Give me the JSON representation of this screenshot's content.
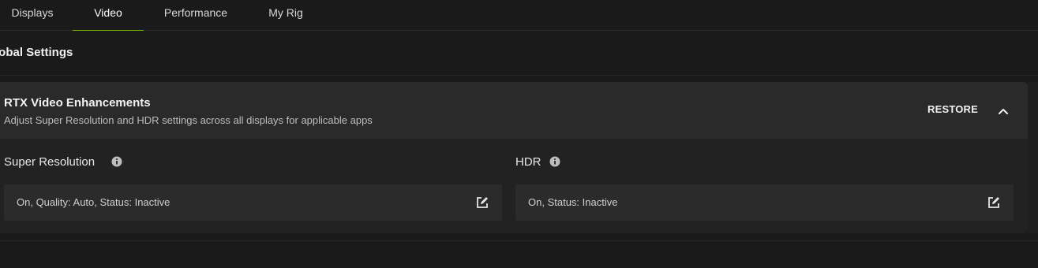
{
  "tabs": [
    {
      "label": "Displays",
      "active": false
    },
    {
      "label": "Video",
      "active": true
    },
    {
      "label": "Performance",
      "active": false
    },
    {
      "label": "My Rig",
      "active": false
    }
  ],
  "section": {
    "title": "lobal Settings"
  },
  "card": {
    "title": "RTX Video Enhancements",
    "subtitle": "Adjust Super Resolution and HDR settings across all displays for applicable apps",
    "restore_label": "RESTORE",
    "collapse_icon": "chevron-up-icon",
    "settings": [
      {
        "label": "Super Resolution",
        "info_icon": "info-icon",
        "value": "On, Quality: Auto, Status: Inactive",
        "edit_icon": "edit-icon"
      },
      {
        "label": "HDR",
        "info_icon": "info-icon",
        "value": "On, Status: Inactive",
        "edit_icon": "edit-icon"
      }
    ]
  },
  "colors": {
    "background": "#1a1a1a",
    "card_header": "#2a2a2a",
    "card_body": "#222222",
    "value_box": "#2b2b2b",
    "accent": "#76b900",
    "text_primary": "#f2f2f2",
    "text_secondary": "#bdbdbd"
  }
}
